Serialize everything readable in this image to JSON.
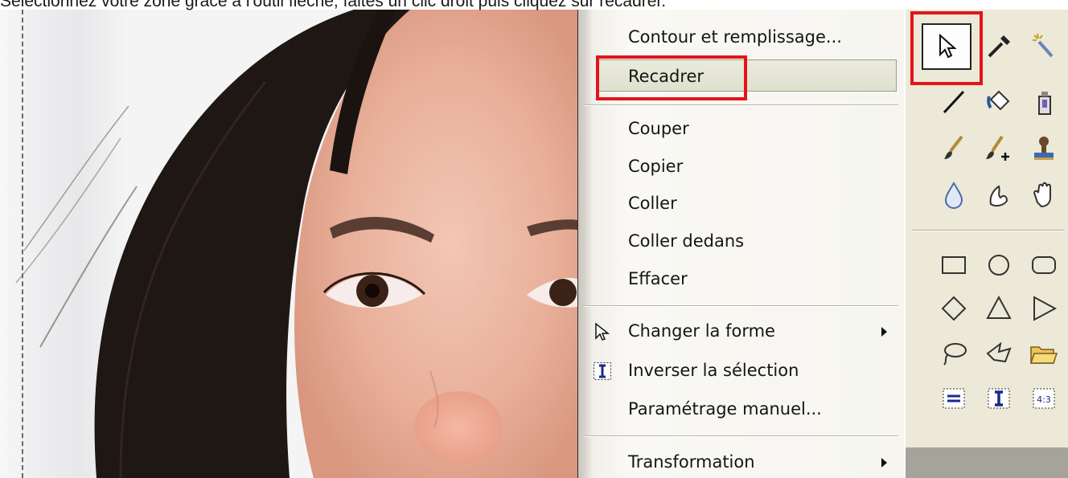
{
  "instruction": "Sélectionnez votre zone grâce à l'outil flèche, faites un clic droit puis cliquez sur recadrer.",
  "context_menu": {
    "items": [
      {
        "label": "Contour et remplissage..."
      },
      {
        "label": "Recadrer",
        "highlighted": true
      },
      {
        "label": "Couper"
      },
      {
        "label": "Copier"
      },
      {
        "label": "Coller"
      },
      {
        "label": "Coller dedans"
      },
      {
        "label": "Effacer"
      },
      {
        "label": "Changer la forme",
        "icon": "arrow-cursor-icon",
        "submenu": true
      },
      {
        "label": "Inverser la sélection",
        "icon": "invert-selection-icon"
      },
      {
        "label": "Paramétrage manuel..."
      },
      {
        "label": "Transformation",
        "submenu": true
      }
    ]
  },
  "toolbox": {
    "tools": [
      "select-arrow-icon",
      "eyedropper-icon",
      "magic-wand-icon",
      "line-icon",
      "paint-bucket-icon",
      "spray-can-icon",
      "brush-icon",
      "brush-plus-icon",
      "stamp-icon",
      "water-drop-icon",
      "smudge-icon",
      "hand-icon",
      "rectangle-icon",
      "ellipse-icon",
      "rounded-rect-icon",
      "diamond-icon",
      "triangle-icon",
      "play-triangle-icon",
      "lasso-icon",
      "polygon-lasso-icon",
      "open-folder-icon",
      "equal-box-icon",
      "text-cursor-box-icon",
      "ratio-box-icon"
    ],
    "ratio_label": "4:3",
    "selected": "select-arrow-icon"
  },
  "colors": {
    "highlight": "#e3141a",
    "menu_bg": "#f6f5f0",
    "toolbox_bg": "#ece9d8"
  }
}
